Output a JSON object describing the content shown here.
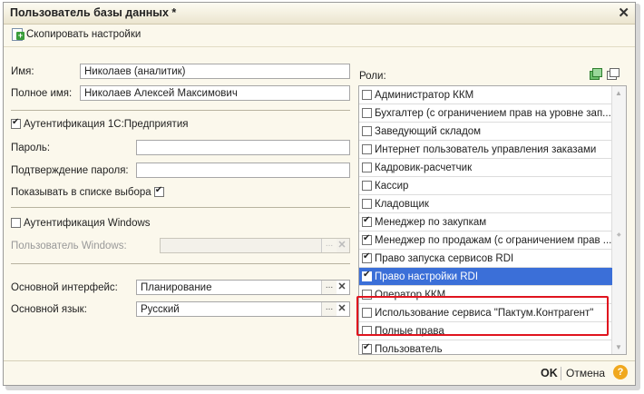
{
  "window": {
    "title": "Пользователь базы данных *"
  },
  "toolbar": {
    "copy_settings": "Скопировать настройки"
  },
  "form": {
    "name_label": "Имя:",
    "name_value": "Николаев (аналитик)",
    "fullname_label": "Полное имя:",
    "fullname_value": "Николаев Алексей Максимович",
    "auth_1c_label": "Аутентификация 1С:Предприятия",
    "password_label": "Пароль:",
    "password_confirm_label": "Подтверждение пароля:",
    "show_in_list_label": "Показывать в списке выбора",
    "auth_windows_label": "Аутентификация Windows",
    "windows_user_label": "Пользователь Windows:",
    "interface_label": "Основной интерфейс:",
    "interface_value": "Планирование",
    "language_label": "Основной язык:",
    "language_value": "Русский"
  },
  "roles": {
    "label": "Роли:",
    "items": [
      {
        "label": "Администратор ККМ",
        "checked": false
      },
      {
        "label": "Бухгалтер (с ограничением прав на уровне зап...",
        "checked": false
      },
      {
        "label": "Заведующий складом",
        "checked": false
      },
      {
        "label": "Интернет пользователь управления заказами",
        "checked": false
      },
      {
        "label": "Кадровик-расчетчик",
        "checked": false
      },
      {
        "label": "Кассир",
        "checked": false
      },
      {
        "label": "Кладовщик",
        "checked": false
      },
      {
        "label": "Менеджер по закупкам",
        "checked": true
      },
      {
        "label": "Менеджер по продажам (с ограничением прав ...",
        "checked": true
      },
      {
        "label": "Право запуска сервисов RDI",
        "checked": true
      },
      {
        "label": "Право настройки RDI",
        "checked": true
      },
      {
        "label": "Оператор ККМ",
        "checked": false
      },
      {
        "label": "Использование сервиса \"Пактум.Контрагент\"",
        "checked": false
      },
      {
        "label": "Полные права",
        "checked": false
      },
      {
        "label": "Пользователь",
        "checked": true
      }
    ]
  },
  "footer": {
    "ok": "OK",
    "cancel": "Отмена",
    "help": "?"
  }
}
